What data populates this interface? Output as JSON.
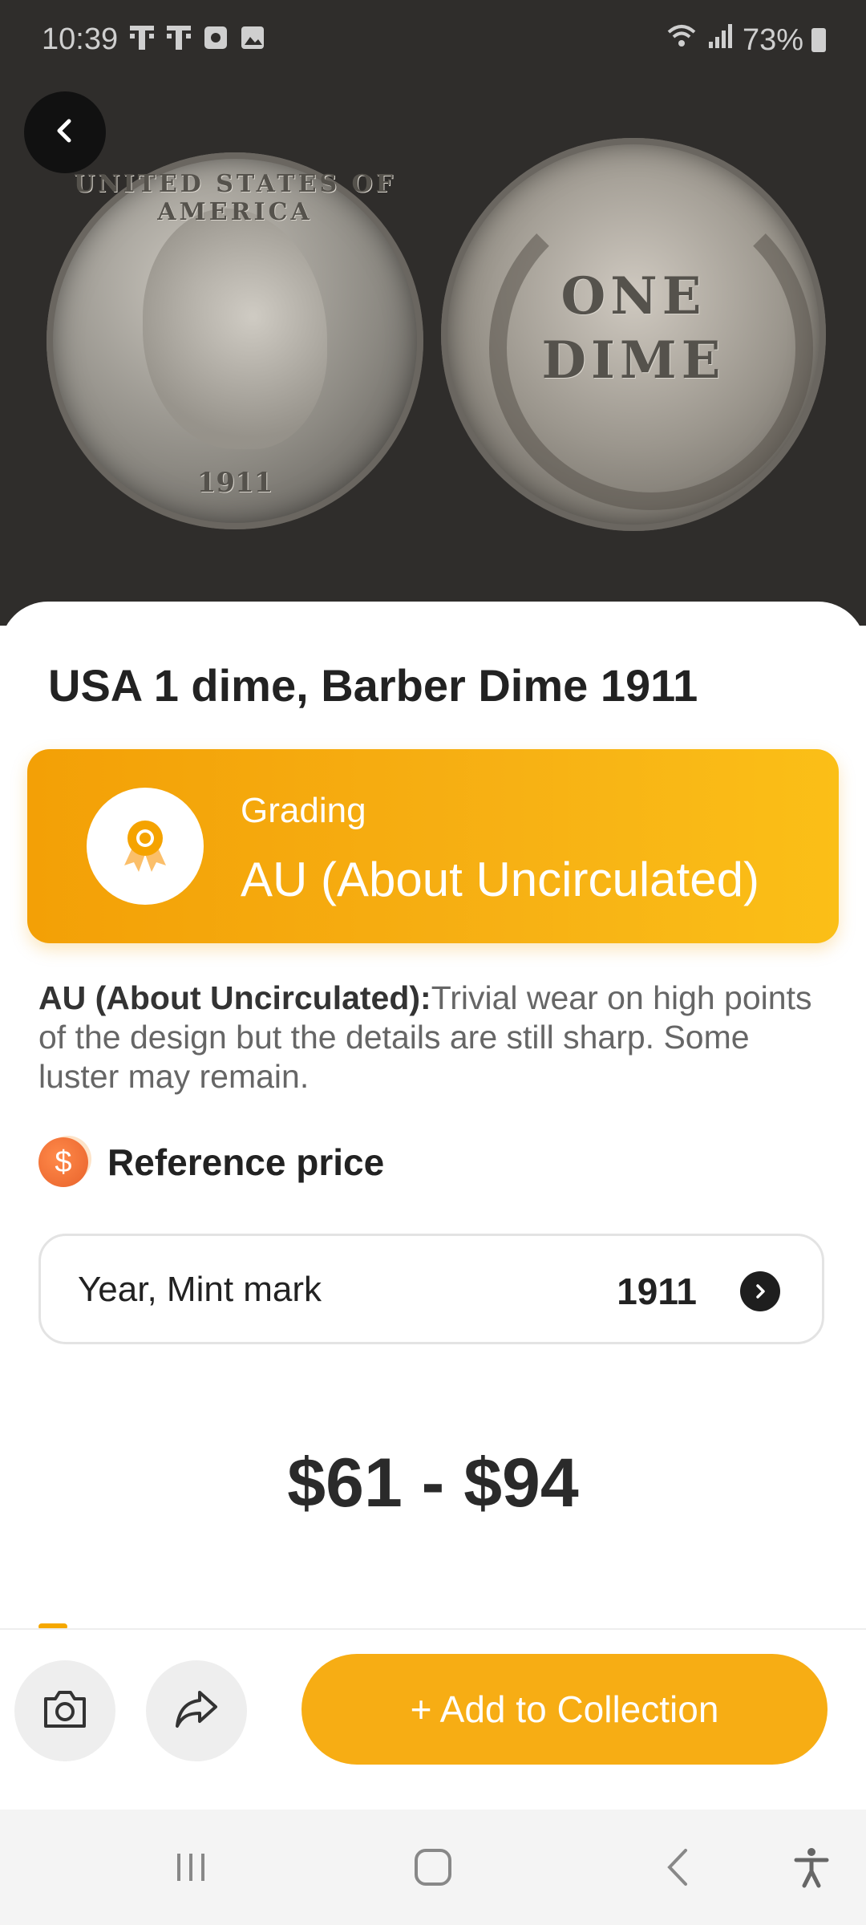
{
  "status_bar": {
    "time": "10:39",
    "battery": "73%",
    "icons": [
      "tmobile-icon",
      "tmobile-icon",
      "notification-icon",
      "image-icon",
      "wifi-icon",
      "signal-icon",
      "battery-icon"
    ]
  },
  "hero": {
    "coin_obverse_year": "1911",
    "coin_obverse_legend": "UNITED STATES OF AMERICA",
    "coin_reverse_line1": "ONE",
    "coin_reverse_line2": "DIME"
  },
  "coin": {
    "title": "USA 1 dime, Barber Dime 1911"
  },
  "grading": {
    "label": "Grading",
    "value": "AU (About Uncirculated)"
  },
  "description": {
    "term": "AU (About Uncirculated):",
    "text": "Trivial wear on high points of the design but the details are still sharp. Some luster may remain."
  },
  "reference": {
    "label": "Reference price",
    "selector_label": "Year, Mint mark",
    "selector_value": "1911",
    "price_range": "$61 - $94"
  },
  "actions": {
    "add_label": "+ Add to Collection"
  },
  "colors": {
    "accent": "#f7ad14",
    "hero_bg": "#2f2d2b",
    "price_icon": "#e8622b"
  }
}
